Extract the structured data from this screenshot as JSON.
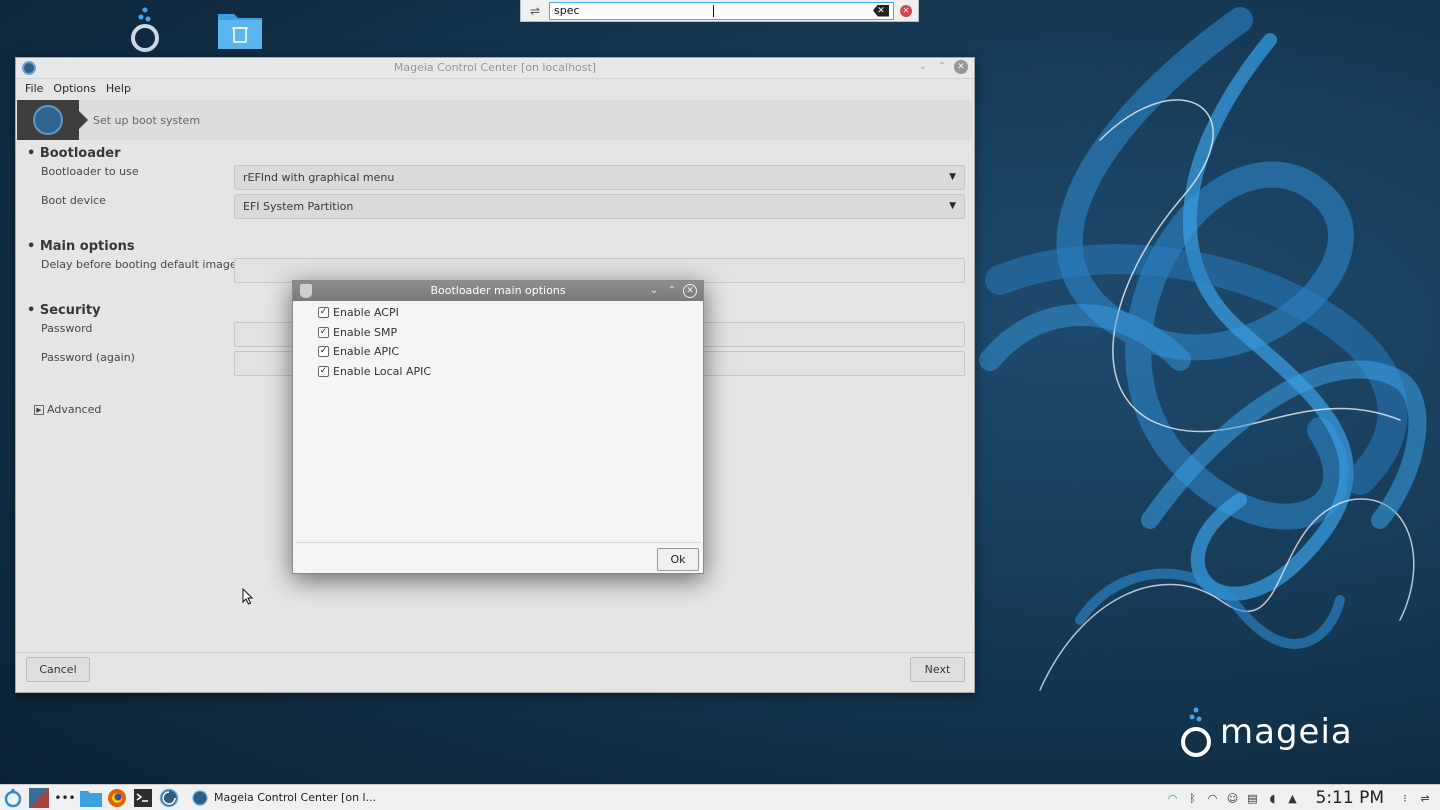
{
  "colors": {
    "wallpaper_dark": "#0f2a40",
    "swirl_blue": "#2f8ad0",
    "dialog_title_bg": "#7a7a7a",
    "accent": "#3daee9"
  },
  "desktop": {
    "icons": [
      "mcc-icon",
      "trash-folder-icon"
    ],
    "brand": "mageia"
  },
  "krunner": {
    "query": "spec"
  },
  "main_window": {
    "title": "Mageia Control Center [on localhost]",
    "menu": [
      "File",
      "Options",
      "Help"
    ],
    "banner_text": "Set up boot system",
    "sections": {
      "bootloader": "Bootloader",
      "main_options": "Main options",
      "security": "Security"
    },
    "fields": {
      "bootloader_to_use_label": "Bootloader to use",
      "bootloader_to_use_value": "rEFInd with graphical menu",
      "boot_device_label": "Boot device",
      "boot_device_value": "EFI System Partition",
      "delay_label": "Delay before booting default image",
      "password_label": "Password",
      "password_again_label": "Password (again)"
    },
    "advanced_label": "Advanced",
    "cancel_label": "Cancel",
    "next_label": "Next"
  },
  "dialog": {
    "title": "Bootloader main options",
    "options": [
      {
        "label": "Enable ACPI",
        "checked": true
      },
      {
        "label": "Enable SMP",
        "checked": true
      },
      {
        "label": "Enable APIC",
        "checked": true
      },
      {
        "label": "Enable Local APIC",
        "checked": true
      }
    ],
    "ok_label": "Ok"
  },
  "taskbar": {
    "task_label": "Mageia Control Center  [on l...",
    "clock": "5:11 PM"
  }
}
